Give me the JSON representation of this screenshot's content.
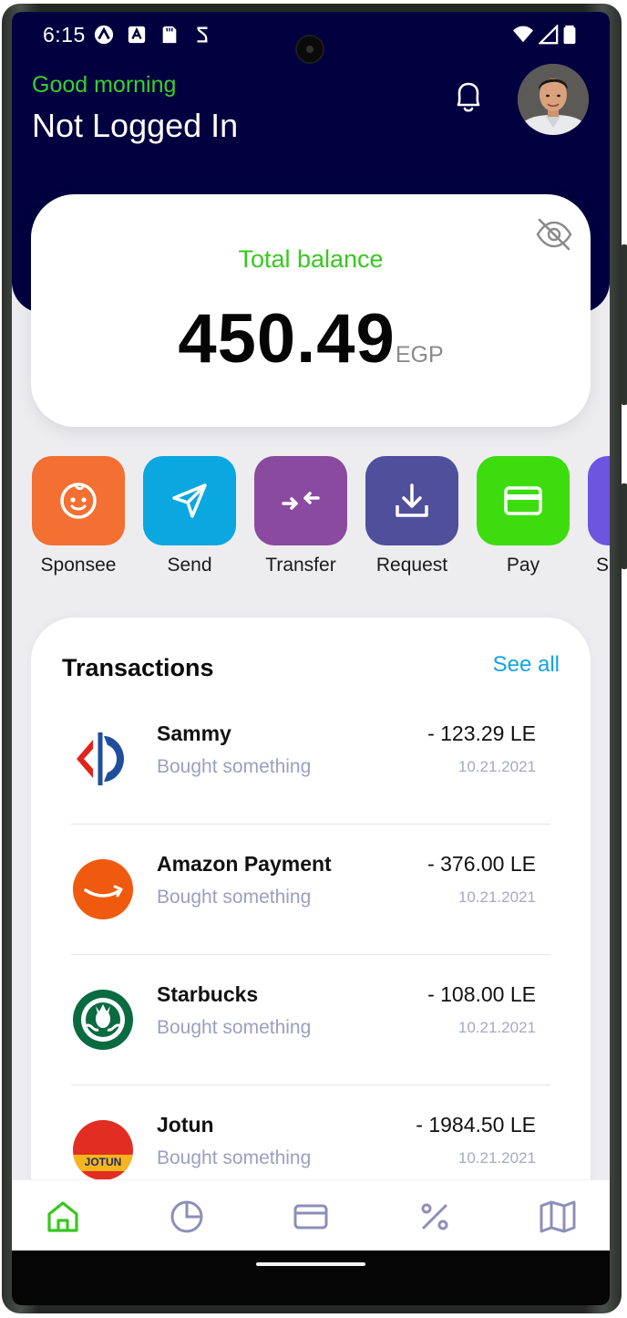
{
  "status_bar": {
    "time": "6:15"
  },
  "header": {
    "greeting": "Good morning",
    "user_name": "Not Logged In"
  },
  "balance": {
    "label": "Total balance",
    "amount": "450.49",
    "currency": "EGP"
  },
  "actions": [
    {
      "label": "Sponsee",
      "color": "#f36f32",
      "icon": "face-icon"
    },
    {
      "label": "Send",
      "color": "#0aa7e0",
      "icon": "send-icon"
    },
    {
      "label": "Transfer",
      "color": "#8a4a9f",
      "icon": "transfer-icon"
    },
    {
      "label": "Request",
      "color": "#4f4f9c",
      "icon": "download-icon"
    },
    {
      "label": "Pay",
      "color": "#3ddc0e",
      "icon": "card-icon"
    },
    {
      "label": "S",
      "color": "#6d55e0",
      "icon": "more-icon"
    }
  ],
  "transactions": {
    "title": "Transactions",
    "see_all": "See all",
    "items": [
      {
        "name": "Sammy",
        "desc": "Bought something",
        "amount": "- 123.29 LE",
        "date": "10.21.2021",
        "logo": "carrefour-logo"
      },
      {
        "name": "Amazon Payment",
        "desc": "Bought something",
        "amount": "- 376.00 LE",
        "date": "10.21.2021",
        "logo": "amazon-logo"
      },
      {
        "name": "Starbucks",
        "desc": "Bought something",
        "amount": "- 108.00 LE",
        "date": "10.21.2021",
        "logo": "starbucks-logo"
      },
      {
        "name": "Jotun",
        "desc": "Bought something",
        "amount": "- 1984.50 LE",
        "date": "10.21.2021",
        "logo": "jotun-logo",
        "logo_text": "JOTUN"
      }
    ]
  },
  "bottom_nav": [
    "home-icon",
    "pie-chart-icon",
    "card-icon",
    "percent-icon",
    "map-icon"
  ],
  "colors": {
    "header_bg": "#02003f",
    "accent_green": "#37c81e",
    "link_blue": "#12a4dd"
  }
}
